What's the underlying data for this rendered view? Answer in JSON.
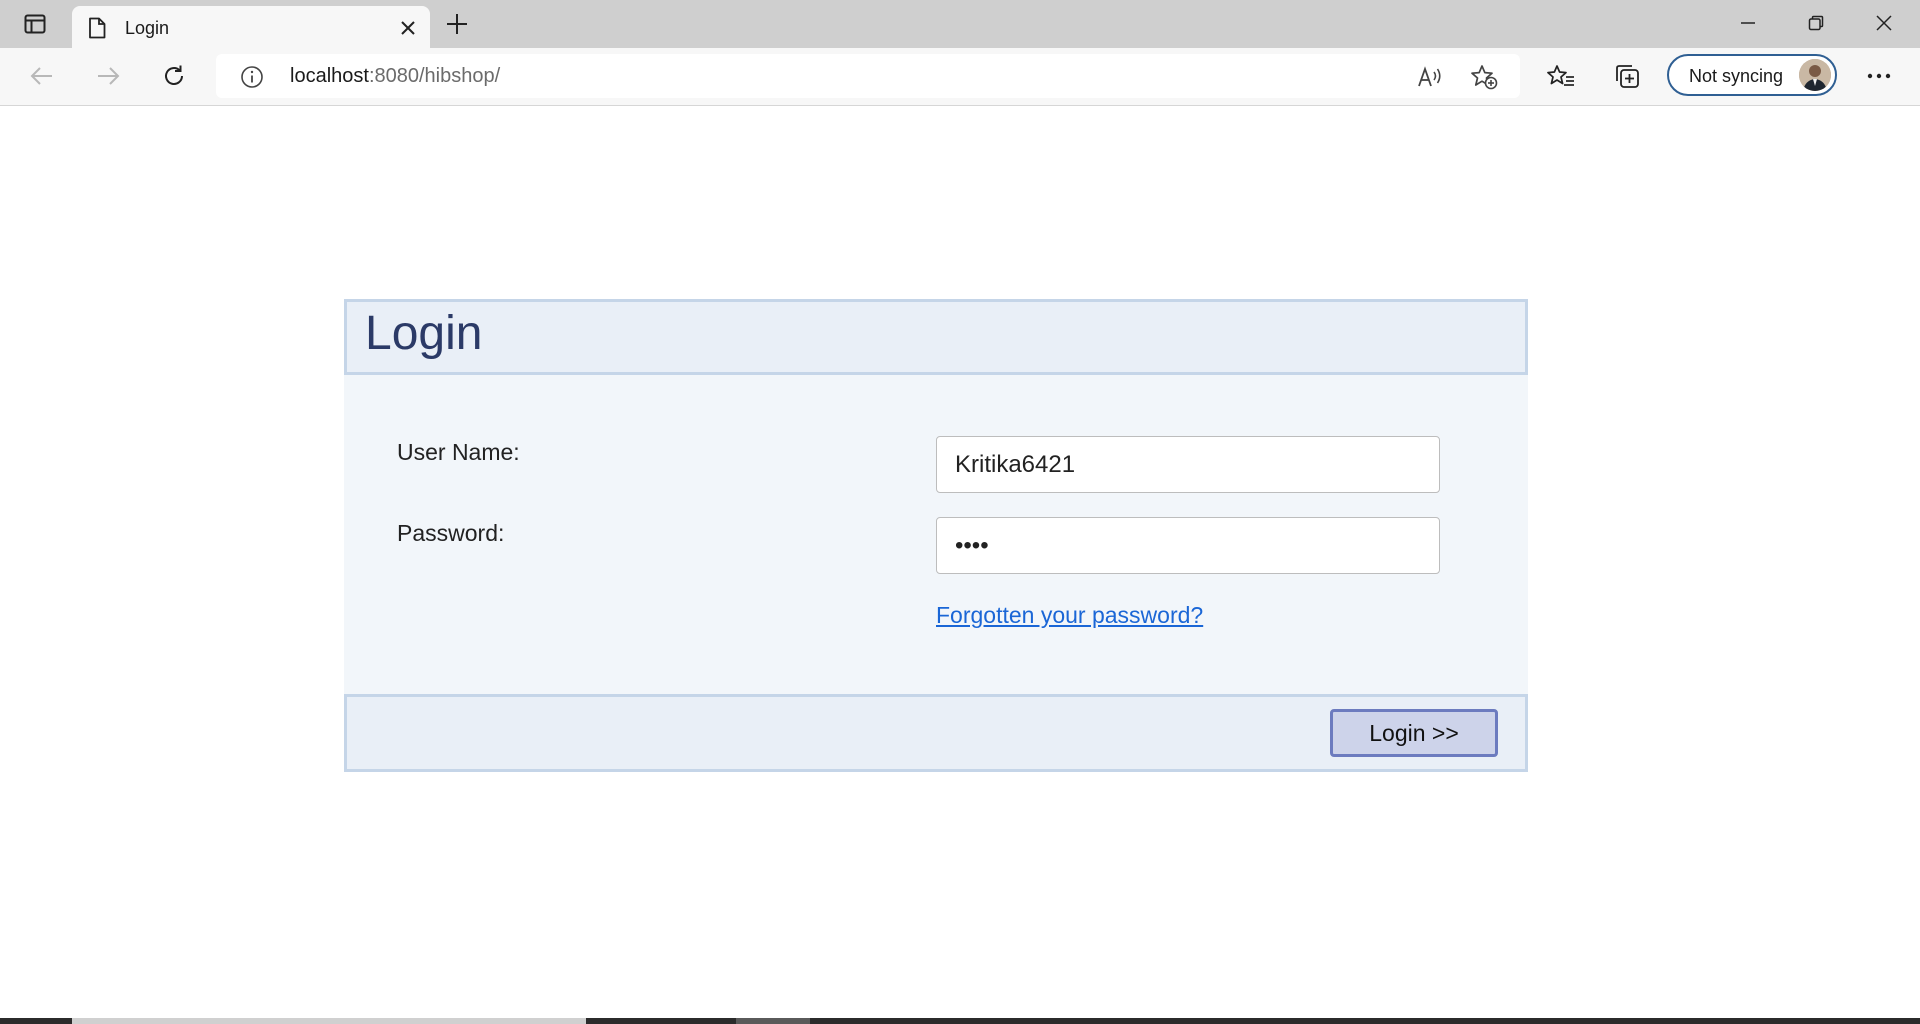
{
  "browser": {
    "tab": {
      "title": "Login"
    },
    "address": {
      "host": "localhost",
      "path": ":8080/hibshop/"
    },
    "profile": {
      "sync_label": "Not syncing"
    }
  },
  "icons": {
    "tab_actions": "tab-actions-icon",
    "page": "page-icon",
    "close_tab": "close-icon",
    "new_tab": "plus-icon",
    "minimize": "minimize-icon",
    "restore": "restore-icon",
    "close_window": "close-icon",
    "back": "back-arrow-icon",
    "forward": "forward-arrow-icon",
    "refresh": "refresh-icon",
    "site_info": "info-icon",
    "read_aloud": "read-aloud-icon",
    "add_favorite": "add-favorite-icon",
    "favorites": "favorites-icon",
    "collections": "collections-icon",
    "more": "more-icon"
  },
  "login": {
    "title": "Login",
    "username_label": "User Name:",
    "username_value": "Kritika6421",
    "password_label": "Password:",
    "password_value": "••••",
    "forgot_link": "Forgotten your password?",
    "submit_label": "Login >>"
  },
  "colors": {
    "header_text": "#2b3a67",
    "panel_bg": "#f2f6fa",
    "panel_border": "#c5d5e8",
    "link": "#1a66d6",
    "button_bg": "#cdd3ea",
    "button_border": "#6c7bbf"
  }
}
